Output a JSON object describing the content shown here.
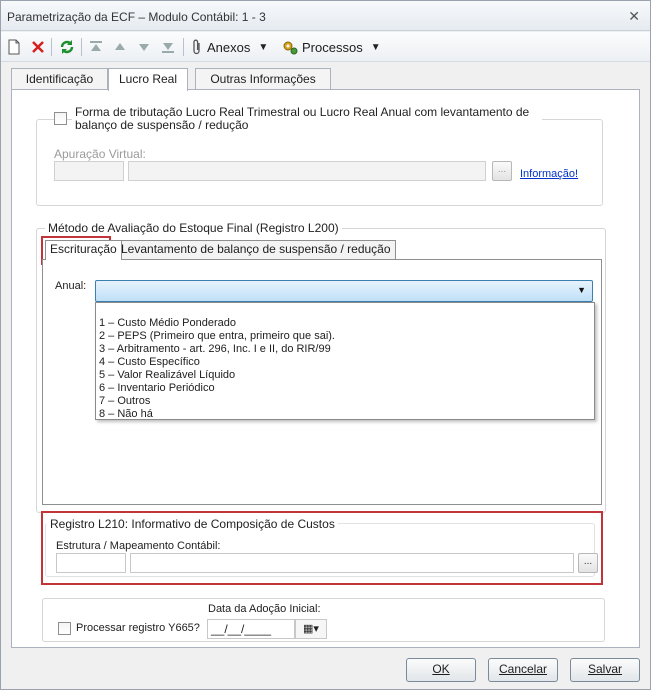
{
  "window": {
    "title": "Parametrização da ECF – Modulo Contábil: 1 - 3"
  },
  "toolbar": {
    "anexos_label": "Anexos",
    "processos_label": "Processos"
  },
  "tabs": [
    {
      "label": "Identificação"
    },
    {
      "label": "Lucro Real"
    },
    {
      "label": "Outras Informações"
    }
  ],
  "lucro_real": {
    "checkbox_label": "Forma de tributação Lucro Real Trimestral ou Lucro Real Anual com levantamento de balanço de suspensão / redução",
    "apuracao_label": "Apuração Virtual:",
    "dots": "...",
    "info_link": "Informação!"
  },
  "estoque": {
    "legend": "Método de Avaliação do Estoque Final (Registro L200)",
    "subtabs": [
      {
        "label": "Escrituração"
      },
      {
        "label": "Levantamento de balanço de suspensão / redução"
      }
    ],
    "anual_label": "Anual:",
    "options": [
      "1 – Custo Médio Ponderado",
      "2 – PEPS (Primeiro que entra, primeiro que sai).",
      "3 – Arbitramento - art. 296, Inc. I e II, do RIR/99",
      "4 – Custo Específico",
      "5 – Valor Realizável Líquido",
      "6 – Inventario Periódico",
      "7 – Outros",
      "8 – Não há"
    ]
  },
  "registro_l210": {
    "legend": "Registro L210: Informativo de Composição de Custos",
    "estrutura_label": "Estrutura / Mapeamento Contábil:",
    "dots": "..."
  },
  "y665": {
    "checkbox_label": "Processar registro Y665?",
    "date_label": "Data da Adoção Inicial:",
    "date_value": "__/__/____"
  },
  "buttons": {
    "ok": "OK",
    "cancelar": "Cancelar",
    "salvar": "Salvar"
  },
  "colors": {
    "highlight_border": "#c0343a",
    "dropdown_border": "#3c7fb1",
    "link": "#0033cc"
  }
}
